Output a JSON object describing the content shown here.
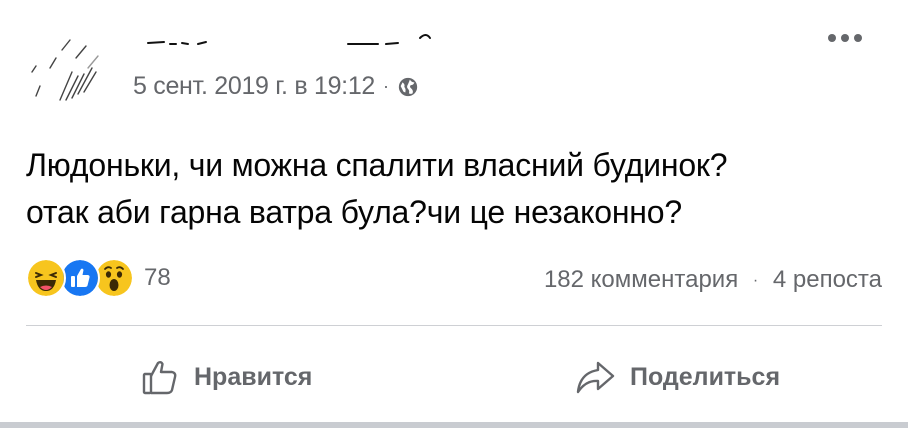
{
  "header": {
    "timestamp": "5 сент. 2019 г. в 19:12",
    "separator": "·",
    "privacy_icon": "globe-icon",
    "more_icon": "more-dots-icon"
  },
  "post": {
    "lines": [
      "Людоньки, чи можна спалити власний будинок?",
      "отак аби гарна ватра була?чи це незаконно?"
    ]
  },
  "reactions": {
    "icons": [
      "haha-icon",
      "like-icon",
      "wow-icon"
    ],
    "count": "78"
  },
  "stats": {
    "comments": "182 комментария",
    "separator": "·",
    "shares": "4 репоста"
  },
  "actions": {
    "like_label": "Нравится",
    "share_label": "Поделиться"
  },
  "colors": {
    "text": "#050505",
    "secondary": "#65676b",
    "like_blue": "#1877f2",
    "emoji_yellow": "#f7c51e",
    "divider": "#ced0d4"
  }
}
